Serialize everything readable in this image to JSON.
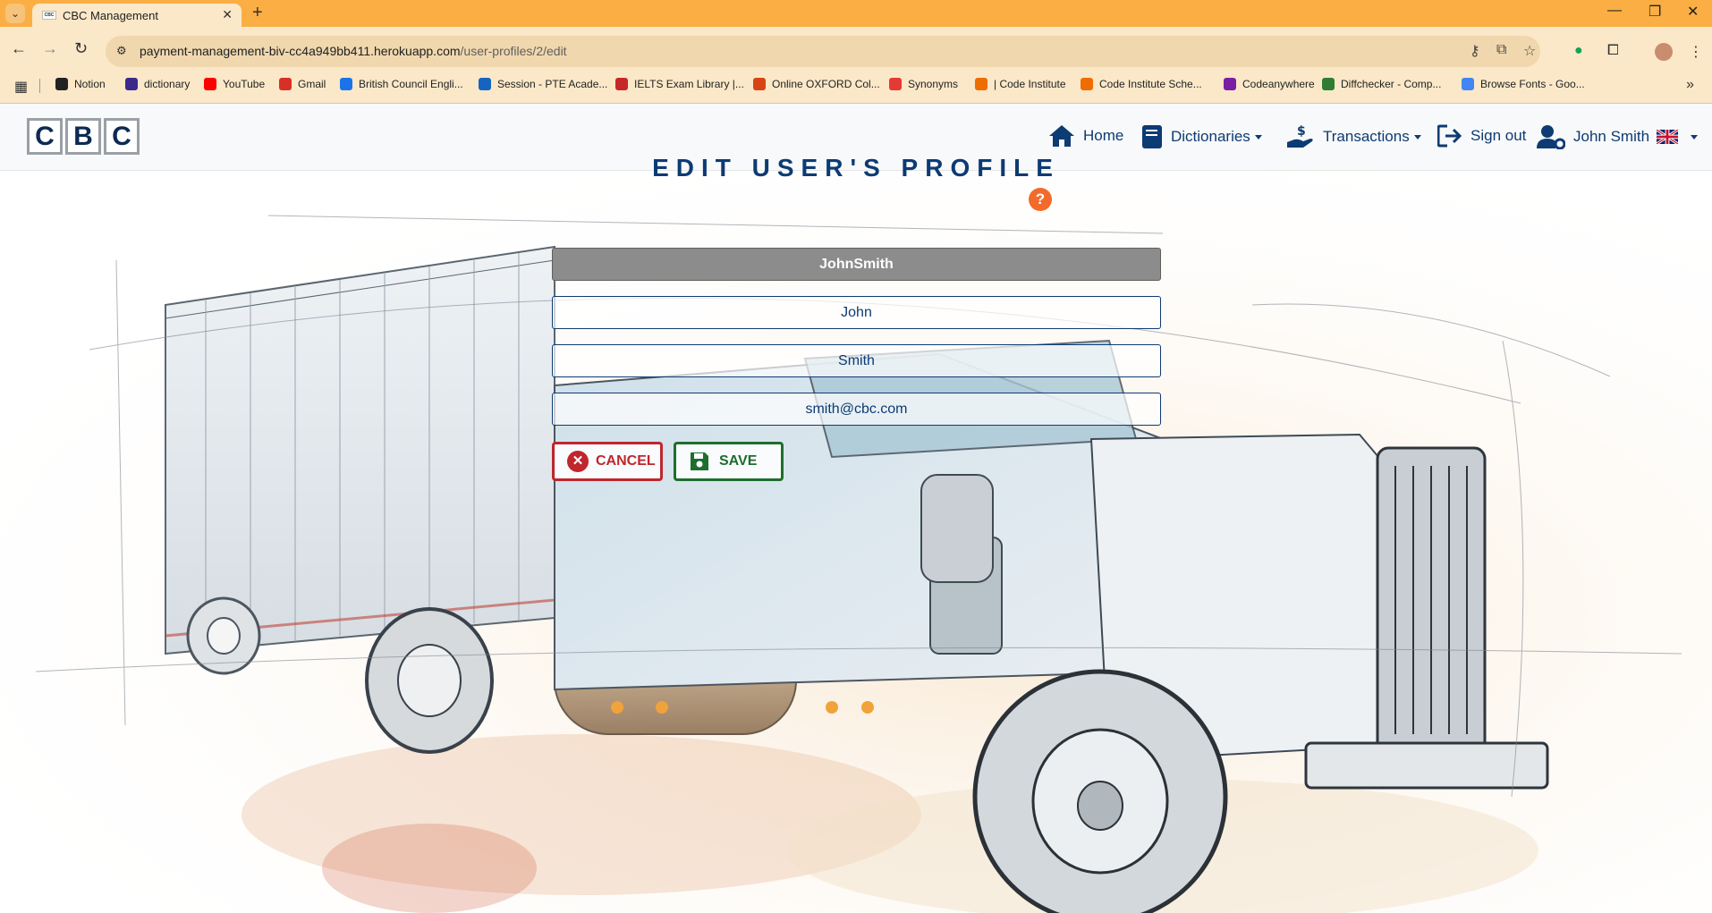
{
  "browser": {
    "tab_title": "CBC Management",
    "tab_favicon_text": "CBC",
    "url_host": "payment-management-biv-cc4a949bb411.herokuapp.com",
    "url_path": "/user-profiles/2/edit",
    "bookmarks": [
      {
        "label": "Notion",
        "color": "#222222"
      },
      {
        "label": "dictionary",
        "color": "#3b2a8c"
      },
      {
        "label": "YouTube",
        "color": "#ff0000"
      },
      {
        "label": "Gmail",
        "color": "#d93025"
      },
      {
        "label": "British Council Engli...",
        "color": "#1a73e8"
      },
      {
        "label": "Session - PTE Acade...",
        "color": "#1565c0"
      },
      {
        "label": "IELTS Exam Library |...",
        "color": "#c62828"
      },
      {
        "label": "Online OXFORD Col...",
        "color": "#d84315"
      },
      {
        "label": "Synonyms",
        "color": "#e53935"
      },
      {
        "label": "| Code Institute",
        "color": "#ef6c00"
      },
      {
        "label": "Code Institute Sche...",
        "color": "#ef6c00"
      },
      {
        "label": "Codeanywhere",
        "color": "#7b1fa2"
      },
      {
        "label": "Diffchecker - Comp...",
        "color": "#2e7d32"
      },
      {
        "label": "Browse Fonts - Goo...",
        "color": "#4285f4"
      }
    ]
  },
  "navbar": {
    "logo_letters": [
      "C",
      "B",
      "C"
    ],
    "home": "Home",
    "dictionaries": "Dictionaries",
    "transactions": "Transactions",
    "sign_out": "Sign out",
    "user": "John Smith"
  },
  "page": {
    "heading": "EDIT USER'S PROFILE",
    "help_icon": "?",
    "form": {
      "username": "JohnSmith",
      "first_name": "John",
      "last_name": "Smith",
      "email": "smith@cbc.com"
    },
    "cancel_label": "CANCEL",
    "save_label": "SAVE"
  },
  "colors": {
    "primary": "#0d3b73",
    "cancel": "#c0262d",
    "save": "#1e6e2e",
    "help": "#f26b2a",
    "chrome_tabstrip": "#fbae43"
  }
}
